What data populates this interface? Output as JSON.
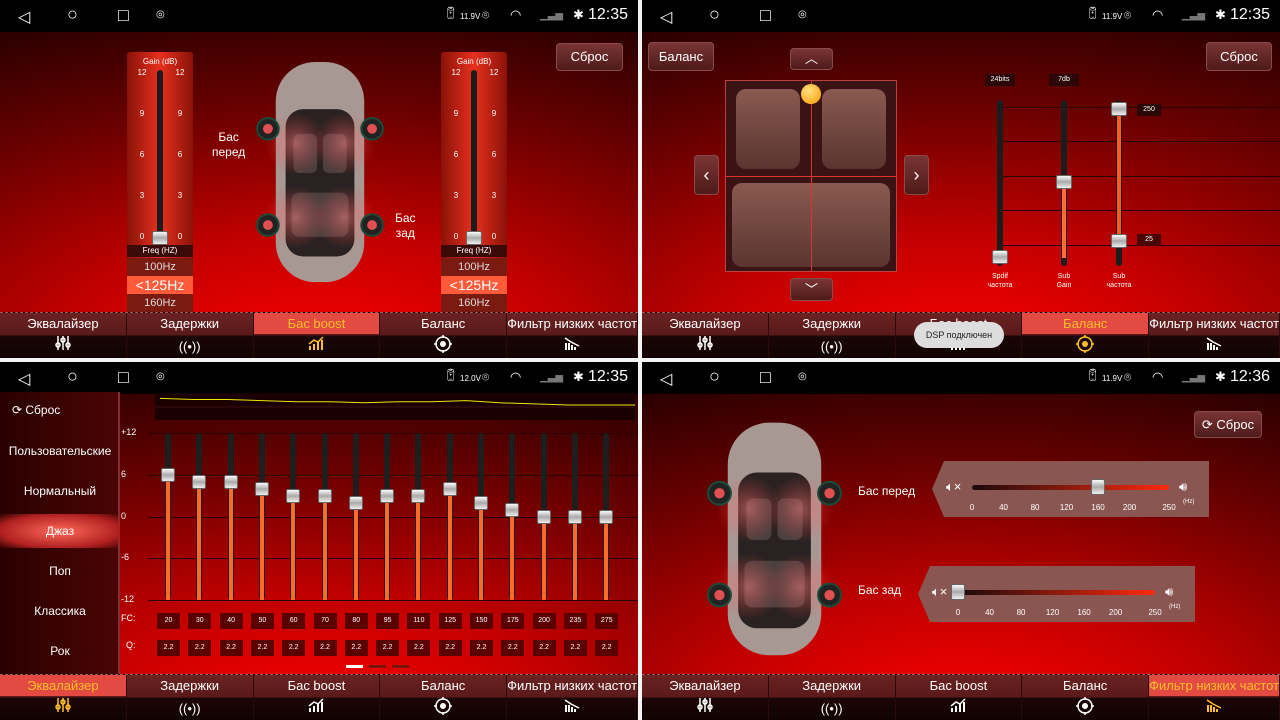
{
  "tabs": [
    "Эквалайзер",
    "Задержки",
    "Бас boost",
    "Баланс",
    "Фильтр низких частот"
  ],
  "tab_icons": [
    "equalizer-icon",
    "surround-icon",
    "bass-boost-icon",
    "balance-icon",
    "lowpass-filter-icon"
  ],
  "colors": {
    "accent": "#ffbf2a",
    "active_tab": "#e34a42",
    "slider_fill": "#ff6a2a"
  },
  "panels": [
    {
      "status": {
        "voltage": "11.9V",
        "time": "12:35"
      },
      "active_tab": 2,
      "reset": "Сброс",
      "gain_title": "Gain",
      "gain_unit": "(dB)",
      "gain_ticks": [
        "12",
        "9",
        "6",
        "3",
        "0"
      ],
      "freq_title": "Freq",
      "freq_unit": "(HZ)",
      "freq_options": [
        "100Hz",
        "<125Hz",
        "160Hz"
      ],
      "front_label": [
        "Бас",
        "перед"
      ],
      "rear_label": [
        "Бас",
        "зад"
      ],
      "front_gain_db": 0,
      "rear_gain_db": 0
    },
    {
      "status": {
        "voltage": "11.9V",
        "time": "12:35"
      },
      "active_tab": 3,
      "balance_btn": "Баланс",
      "reset": "Сброс",
      "sliders": [
        {
          "top": "24bits",
          "label": [
            "Spdif",
            "частота"
          ],
          "value": 0
        },
        {
          "top": "7db",
          "label": [
            "Sub",
            "Gain"
          ],
          "value": 0.5
        },
        {
          "top": "",
          "label": [
            "Sub",
            "частота"
          ],
          "high": "250",
          "low": "25"
        }
      ],
      "toast": "DSP подключен"
    },
    {
      "status": {
        "voltage": "12.0V",
        "time": "12:35"
      },
      "active_tab": 0,
      "presets": {
        "reset": "Сброс",
        "items": [
          "Пользовательские",
          "Нормальный",
          "Джаз",
          "Поп",
          "Классика",
          "Рок"
        ],
        "selected": 2
      },
      "chart_data": {
        "type": "bar",
        "y_ticks": [
          "+12",
          "6",
          "0",
          "-6",
          "-12"
        ],
        "ylim": [
          -12,
          12
        ],
        "fc_label": "FC:",
        "q_label": "Q:",
        "fc": [
          "20",
          "30",
          "40",
          "50",
          "60",
          "70",
          "80",
          "95",
          "110",
          "125",
          "150",
          "175",
          "200",
          "235",
          "275"
        ],
        "gain": [
          6,
          5,
          5,
          4,
          3,
          3,
          2,
          3,
          3,
          4,
          2,
          1,
          0,
          0,
          0
        ],
        "q": [
          "2.2",
          "2.2",
          "2.2",
          "2.2",
          "2.2",
          "2.2",
          "2.2",
          "2.2",
          "2.2",
          "2.2",
          "2.2",
          "2.2",
          "2.2",
          "2.2",
          "2.2"
        ],
        "page": 1,
        "pages": 3
      }
    },
    {
      "status": {
        "voltage": "11.9V",
        "time": "12:36"
      },
      "active_tab": 4,
      "reset": "Сброс",
      "front": {
        "label": "Бас перед",
        "value": 160
      },
      "rear": {
        "label": "Бас зад",
        "value": 0
      },
      "ticks": [
        "0",
        "40",
        "80",
        "120",
        "160",
        "200",
        "250"
      ],
      "unit": "(Hz)"
    }
  ]
}
